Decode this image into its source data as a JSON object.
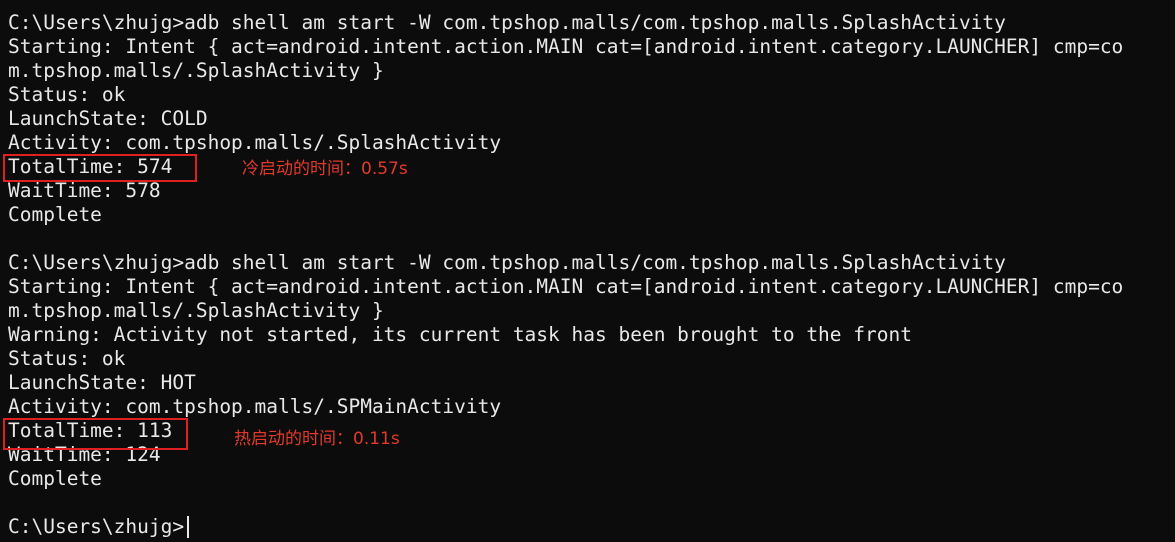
{
  "colors": {
    "background": "#0c0c0c",
    "text": "#e8e8e8",
    "annotation": "#e23a2a",
    "highlight_box": "#e02020"
  },
  "terminal": {
    "lines": [
      "C:\\Users\\zhujg>adb shell am start -W com.tpshop.malls/com.tpshop.malls.SplashActivity",
      "Starting: Intent { act=android.intent.action.MAIN cat=[android.intent.category.LAUNCHER] cmp=co",
      "m.tpshop.malls/.SplashActivity }",
      "Status: ok",
      "LaunchState: COLD",
      "Activity: com.tpshop.malls/.SplashActivity",
      "TotalTime: 574",
      "WaitTime: 578",
      "Complete",
      "",
      "C:\\Users\\zhujg>adb shell am start -W com.tpshop.malls/com.tpshop.malls.SplashActivity",
      "Starting: Intent { act=android.intent.action.MAIN cat=[android.intent.category.LAUNCHER] cmp=co",
      "m.tpshop.malls/.SplashActivity }",
      "Warning: Activity not started, its current task has been brought to the front",
      "Status: ok",
      "LaunchState: HOT",
      "Activity: com.tpshop.malls/.SPMainActivity",
      "TotalTime: 113",
      "WaitTime: 124",
      "Complete",
      "",
      "C:\\Users\\zhujg>"
    ]
  },
  "annotations": {
    "cold_start": "冷启动的时间：0.57s",
    "hot_start": "热启动的时间：0.11s"
  }
}
